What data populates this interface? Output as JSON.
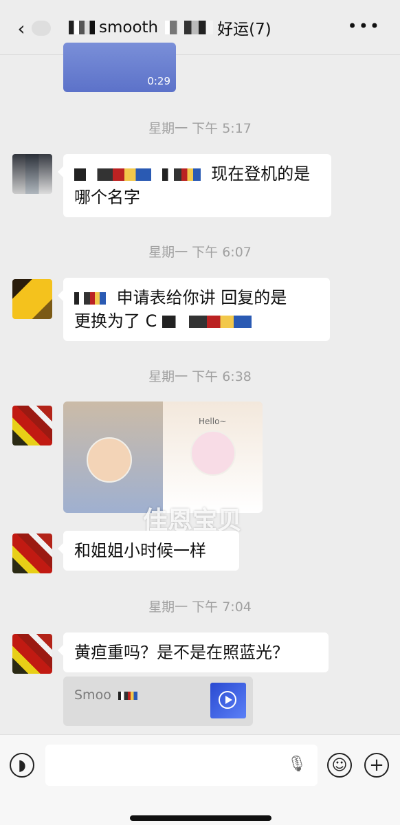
{
  "header": {
    "back_glyph": "‹",
    "title_prefix": "smooth",
    "title_suffix": "好运(7)",
    "more_glyph": "•••"
  },
  "video_top": {
    "duration": "0:29"
  },
  "messages": [
    {
      "timestamp": "星期一 下午 5:17",
      "text_line1": "现在登机的是",
      "text_line2": "哪个名字"
    },
    {
      "timestamp": "星期一 下午 6:07",
      "text_line1": "申请表给你讲 回复的是",
      "text_line2": "更换为了 C"
    },
    {
      "timestamp": "星期一 下午 6:38",
      "image_caption_left": "",
      "image_caption_right": "Hello~",
      "watermark": "佳恩宝贝"
    },
    {
      "timestamp": "",
      "text": "和姐姐小时候一样"
    },
    {
      "timestamp": "星期一 下午 7:04",
      "text": "黄疸重吗？是不是在照蓝光？",
      "quote_text": "Smoo"
    }
  ],
  "input_bar": {
    "voice_icon": "◗",
    "mic_icon": "🎙",
    "emoji_icon": "☺",
    "add_icon": "+"
  },
  "colors": {
    "background": "#ededed",
    "bubble": "#ffffff",
    "timestamp": "#a0a0a0",
    "accent_blue": "#3a5bd9"
  }
}
